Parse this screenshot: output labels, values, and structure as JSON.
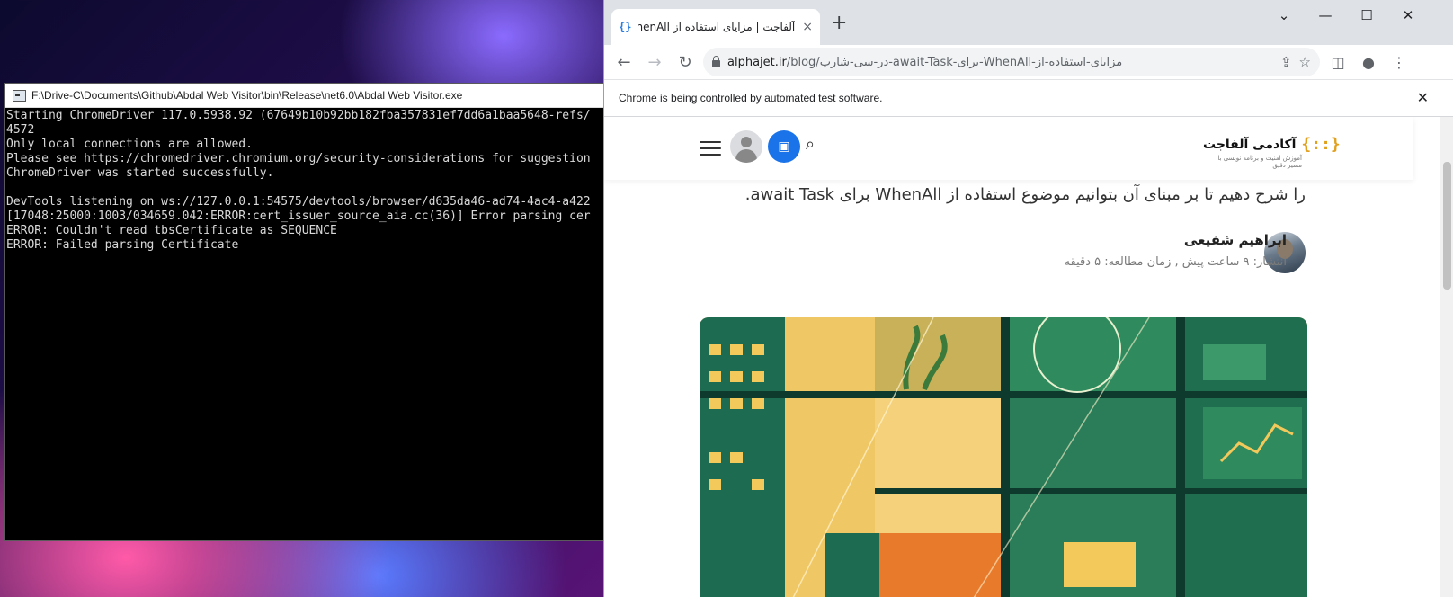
{
  "console": {
    "title": "F:\\Drive-C\\Documents\\Github\\Abdal Web Visitor\\bin\\Release\\net6.0\\Abdal Web Visitor.exe",
    "lines": [
      "Starting ChromeDriver 117.0.5938.92 (67649b10b92bb182fba357831ef7dd6a1baa5648-refs/",
      "4572",
      "Only local connections are allowed.",
      "Please see https://chromedriver.chromium.org/security-considerations for suggestion",
      "ChromeDriver was started successfully.",
      "",
      "DevTools listening on ws://127.0.0.1:54575/devtools/browser/d635da46-ad74-4ac4-a422",
      "[17048:25000:1003/034659.042:ERROR:cert_issuer_source_aia.cc(36)] Error parsing cer",
      "ERROR: Couldn't read tbsCertificate as SEQUENCE",
      "ERROR: Failed parsing Certificate"
    ]
  },
  "chrome": {
    "tab": {
      "favicon": "{}",
      "title": "آلفاجت | مزایای استفاده از WhenAll",
      "close": "×"
    },
    "newtab": "+",
    "window_controls": {
      "dropdown": "⌄",
      "minimize": "—",
      "maximize": "☐",
      "close": "✕"
    },
    "nav": {
      "back": "←",
      "forward": "→",
      "reload": "↻"
    },
    "url": {
      "host": "alphajet.ir",
      "path": "/blog/در-سی-شارپ-await-Task-برای-WhenAll-مزایای-استفاده-از"
    },
    "icons": {
      "share": "⇪",
      "bookmark": "☆",
      "sidepanel": "◫",
      "profile": "●",
      "menu": "⋮"
    },
    "infobar": {
      "text": "Chrome is being controlled by automated test software.",
      "close": "✕"
    }
  },
  "page": {
    "logo": {
      "mark": "{::}",
      "text": "آکادمی آلفاجت",
      "subtitle": "آموزش امنیت و برنامه نویسی با مسیر دقیق"
    },
    "header_icons": {
      "search": "⌕",
      "wallet": "▣"
    },
    "intro": "را شرح دهیم تا بر مبنای آن بتوانیم موضوع استفاده از WhenAll برای await Task.",
    "author": {
      "name": "ابراهیم شفیعی",
      "meta": "انتشار: ۹ ساعت پیش , زمان مطالعه: ۵ دقیقه"
    },
    "hero_alt": "آکادمی آلفاجت"
  }
}
